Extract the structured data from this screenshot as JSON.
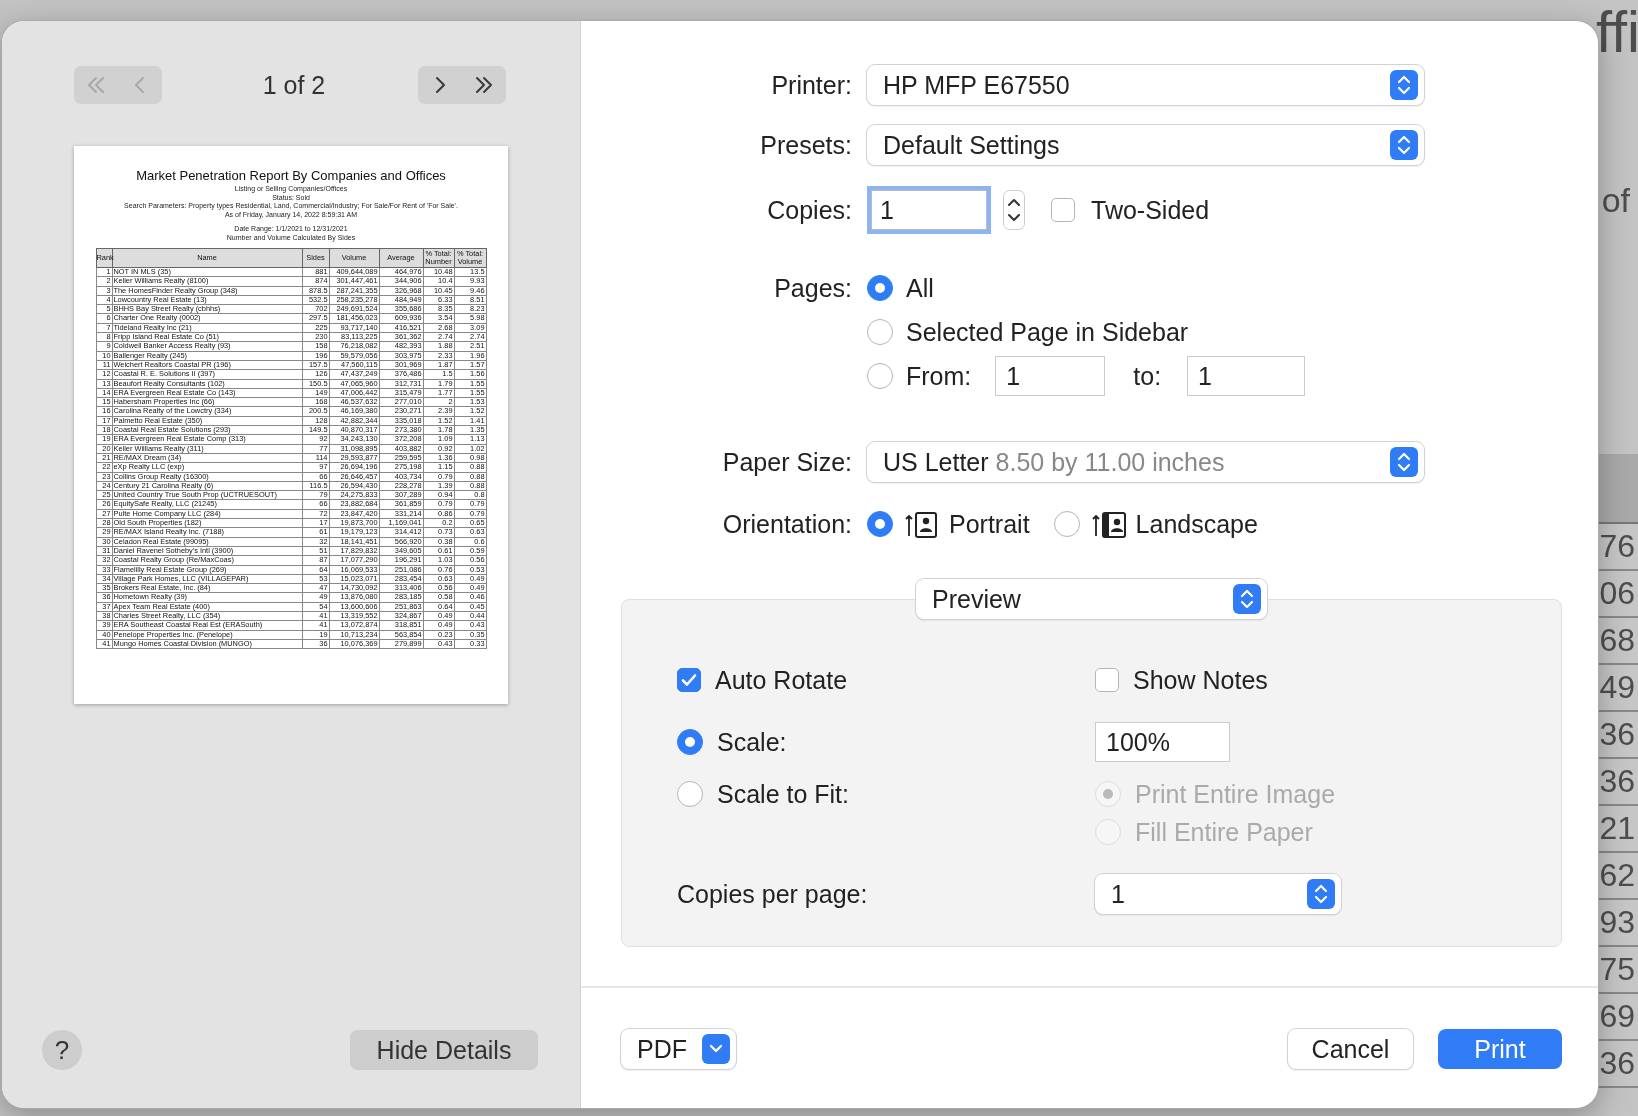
{
  "background": {
    "title": "ffi",
    "side_text": "of",
    "column_fragments": [
      "76",
      "06",
      "68",
      "49",
      "36",
      "36",
      "21",
      "62",
      "93",
      "75",
      "69",
      "36"
    ]
  },
  "sidebar": {
    "nav_buttons": [
      {
        "kind": "first",
        "disabled": true
      },
      {
        "kind": "previous",
        "disabled": true
      },
      {
        "kind": "next",
        "disabled": false
      },
      {
        "kind": "last",
        "disabled": false
      }
    ],
    "page_indicator": "1 of 2",
    "page_preview": {
      "title": "Market Penetration Report By Companies and Offices",
      "header_lines": [
        "Listing or Selling Companies/Offices",
        "Status: Sold",
        "Search Parameters: Property types Residential, Land, Commercial/Industry; For Sale/For Rent of 'For Sale'.",
        "As of Friday, January 14, 2022 8:59:31 AM"
      ],
      "range_lines": [
        "Date Range: 1/1/2021 to 12/31/2021",
        "Number and Volume Calculated By Sides"
      ],
      "table": {
        "columns": [
          "Rank",
          "Name",
          "Sides",
          "Volume",
          "Average",
          "% Total: Number",
          "% Total: Volume"
        ],
        "rows": [
          [
            "1",
            "NOT IN MLS (35)",
            "881",
            "409,644,089",
            "464,976",
            "10.48",
            "13.5"
          ],
          [
            "2",
            "Keller Williams Realty (8100)",
            "874",
            "301,447,461",
            "344,906",
            "10.4",
            "9.93"
          ],
          [
            "3",
            "The HomesFinder Realty Group (348)",
            "878.5",
            "287,241,355",
            "326,968",
            "10.45",
            "9.46"
          ],
          [
            "4",
            "Lowcountry Real Estate (13)",
            "532.5",
            "258,235,278",
            "484,949",
            "6.33",
            "8.51"
          ],
          [
            "5",
            "BHHS Bay Street Realty (cbhhs)",
            "702",
            "249,691,524",
            "355,686",
            "8.35",
            "8.23"
          ],
          [
            "6",
            "Charter One Realty (0002)",
            "297.5",
            "181,456,023",
            "609,936",
            "3.54",
            "5.98"
          ],
          [
            "7",
            "Tideland Realty Inc (21)",
            "225",
            "93,717,140",
            "416,521",
            "2.68",
            "3.09"
          ],
          [
            "8",
            "Fripp Island Real Estate Co (51)",
            "230",
            "83,113,225",
            "361,362",
            "2.74",
            "2.74"
          ],
          [
            "9",
            "Coldwell Banker Access Realty (93)",
            "158",
            "76,218,082",
            "482,393",
            "1.88",
            "2.51"
          ],
          [
            "10",
            "Ballenger Realty (245)",
            "196",
            "59,579,056",
            "303,975",
            "2.33",
            "1.96"
          ],
          [
            "11",
            "Weichert Realtors Coastal PR (196)",
            "157.5",
            "47,560,115",
            "301,969",
            "1.87",
            "1.57"
          ],
          [
            "12",
            "Coastal R. E. Solutions II (397)",
            "126",
            "47,437,249",
            "376,486",
            "1.5",
            "1.56"
          ],
          [
            "13",
            "Beaufort Realty Consultants (102)",
            "150.5",
            "47,065,960",
            "312,731",
            "1.79",
            "1.55"
          ],
          [
            "14",
            "ERA Evergreen Real Estate Co (143)",
            "149",
            "47,006,442",
            "315,479",
            "1.77",
            "1.55"
          ],
          [
            "15",
            "Habersham Properties Inc (66)",
            "168",
            "46,537,632",
            "277,010",
            "2",
            "1.53"
          ],
          [
            "16",
            "Carolina Realty of the Lowctry (334)",
            "200.5",
            "46,169,380",
            "230,271",
            "2.39",
            "1.52"
          ],
          [
            "17",
            "Palmetto Real Estate (350)",
            "128",
            "42,882,344",
            "335,018",
            "1.52",
            "1.41"
          ],
          [
            "18",
            "Coastal Real Estate Solutions (293)",
            "149.5",
            "40,870,317",
            "273,380",
            "1.78",
            "1.35"
          ],
          [
            "19",
            "ERA Evergreen Real Estate Comp (313)",
            "92",
            "34,243,130",
            "372,208",
            "1.09",
            "1.13"
          ],
          [
            "20",
            "Keller Williams Realty (311)",
            "77",
            "31,098,895",
            "403,882",
            "0.92",
            "1.02"
          ],
          [
            "21",
            "RE/MAX Dream (34)",
            "114",
            "29,593,877",
            "259,595",
            "1.36",
            "0.98"
          ],
          [
            "22",
            "eXp Realty LLC (exp)",
            "97",
            "26,694,196",
            "275,198",
            "1.15",
            "0.88"
          ],
          [
            "23",
            "Collins Group Realty (16300)",
            "66",
            "26,646,457",
            "403,734",
            "0.79",
            "0.88"
          ],
          [
            "24",
            "Century 21 Carolina Realty (6)",
            "116.5",
            "26,594,430",
            "228,278",
            "1.39",
            "0.88"
          ],
          [
            "25",
            "United Country True South Prop (UCTRUESOUT)",
            "79",
            "24,275,833",
            "307,289",
            "0.94",
            "0.8"
          ],
          [
            "26",
            "EquitySafe Realty, LLC (21245)",
            "66",
            "23,882,684",
            "361,859",
            "0.79",
            "0.79"
          ],
          [
            "27",
            "Pulte Home Company LLC (284)",
            "72",
            "23,847,420",
            "331,214",
            "0.86",
            "0.79"
          ],
          [
            "28",
            "Old South Properties (182)",
            "17",
            "19,873,700",
            "1,169,041",
            "0.2",
            "0.65"
          ],
          [
            "29",
            "RE/MAX Island Realty Inc. (7188)",
            "61",
            "19,179,123",
            "314,412",
            "0.73",
            "0.63"
          ],
          [
            "30",
            "Celadon Real Estate (99095)",
            "32",
            "18,141,451",
            "566,920",
            "0.38",
            "0.6"
          ],
          [
            "31",
            "Daniel Ravenel Sotheby's Intl (3900)",
            "51",
            "17,829,832",
            "349,605",
            "0.61",
            "0.59"
          ],
          [
            "32",
            "Coastal Realty Group (Re/MaxCoas)",
            "87",
            "17,077,290",
            "196,291",
            "1.03",
            "0.56"
          ],
          [
            "33",
            "Flamelilly Real Estate Group (269)",
            "64",
            "16,069,533",
            "251,086",
            "0.76",
            "0.53"
          ],
          [
            "34",
            "Village Park Homes, LLC (VILLAGEPAR)",
            "53",
            "15,023,071",
            "283,454",
            "0.63",
            "0.49"
          ],
          [
            "35",
            "Brokers Real Estate, Inc. (84)",
            "47",
            "14,730,092",
            "313,406",
            "0.56",
            "0.49"
          ],
          [
            "36",
            "Hometown Realty (39)",
            "49",
            "13,876,080",
            "283,185",
            "0.58",
            "0.46"
          ],
          [
            "37",
            "Apex Team Real Estate (400)",
            "54",
            "13,600,606",
            "251,863",
            "0.64",
            "0.45"
          ],
          [
            "38",
            "Charles Street Realty, LLC (354)",
            "41",
            "13,319,552",
            "324,867",
            "0.49",
            "0.44"
          ],
          [
            "39",
            "ERA Southeast Coastal Real Est (ERASouth)",
            "41",
            "13,072,874",
            "318,851",
            "0.49",
            "0.43"
          ],
          [
            "40",
            "Penelope Properties Inc. (Penelope)",
            "19",
            "10,713,234",
            "563,854",
            "0.23",
            "0.35"
          ],
          [
            "41",
            "Mungo Homes Coastal Division (MUNGO)",
            "36",
            "10,076,369",
            "279,899",
            "0.43",
            "0.33"
          ]
        ]
      }
    },
    "help_button": "?",
    "hide_details_button": "Hide Details"
  },
  "form": {
    "printer": {
      "label": "Printer:",
      "value": "HP MFP E67550"
    },
    "presets": {
      "label": "Presets:",
      "value": "Default Settings"
    },
    "copies": {
      "label": "Copies:",
      "value": "1",
      "focused": true
    },
    "two_sided": {
      "label": "Two-Sided",
      "checked": false
    },
    "pages": {
      "label": "Pages:",
      "options": [
        {
          "kind": "plain",
          "label": "All",
          "selected": true
        },
        {
          "kind": "plain",
          "label": "Selected Page in Sidebar",
          "selected": false
        },
        {
          "kind": "range",
          "label": "From:",
          "selected": false
        }
      ],
      "from": "1",
      "to_label": "to:",
      "to": "1"
    },
    "paper_size": {
      "label": "Paper Size:",
      "value": "US Letter",
      "detail": "8.50 by 11.00 inches"
    },
    "orientation": {
      "label": "Orientation:",
      "options": [
        {
          "kind": "portrait",
          "label": "Portrait",
          "selected": true
        },
        {
          "kind": "landscape",
          "label": "Landscape",
          "selected": false
        }
      ]
    }
  },
  "section_menu": "Preview",
  "preview_options": {
    "auto_rotate": {
      "label": "Auto Rotate",
      "checked": true
    },
    "show_notes": {
      "label": "Show Notes",
      "checked": false
    },
    "scale_modes": [
      {
        "label": "Scale:",
        "selected": true
      },
      {
        "label": "Scale to Fit:",
        "selected": false
      }
    ],
    "scale_value": "100%",
    "fit_options": [
      {
        "label": "Print Entire Image",
        "selected": true,
        "disabled": true
      },
      {
        "label": "Fill Entire Paper",
        "selected": false,
        "disabled": true
      }
    ],
    "copies_per_page": {
      "label": "Copies per page:",
      "value": "1"
    }
  },
  "footer": {
    "pdf_button": "PDF",
    "cancel_button": "Cancel",
    "print_button": "Print"
  }
}
